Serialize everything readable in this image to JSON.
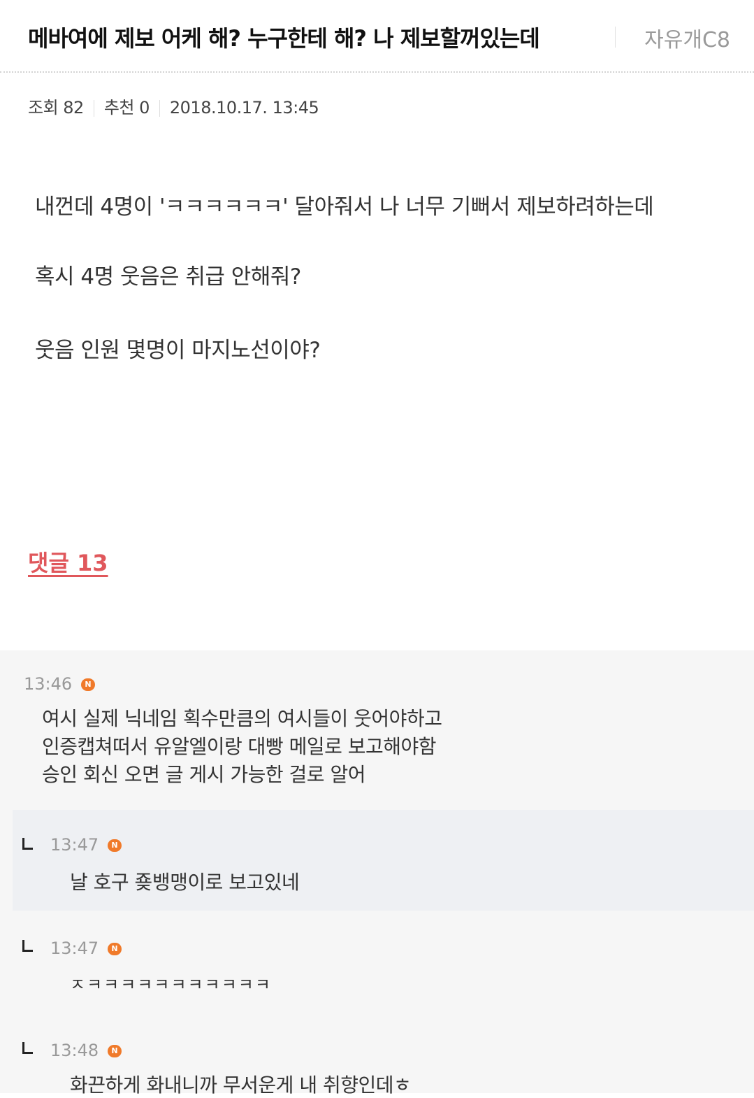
{
  "post": {
    "title": "메바여에 제보 어케 해? 누구한테 해? 나 제보할꺼있는데",
    "board": "자유개C8",
    "views": "조회 82",
    "recommend": "추천 0",
    "date": "2018.10.17. 13:45",
    "body": [
      "내껀데 4명이 'ㅋㅋㅋㅋㅋㅋ' 달아줘서 나 너무 기뻐서 제보하려하는데",
      "혹시 4명 웃음은 취급 안해줘?",
      "웃음 인원 몇명이 마지노선이야?"
    ]
  },
  "comments_link": "댓글 13",
  "comments": [
    {
      "time": "13:46",
      "badge": "N",
      "lines": [
        "여시 실제 닉네임 획수만큼의 여시들이 웃어야하고",
        "인증캡쳐떠서 유알엘이랑 대빵 메일로 보고해야함",
        "승인 회신 오면 글 게시 가능한 걸로 알어"
      ]
    },
    {
      "time": "13:47",
      "badge": "N",
      "text": "날 호구 죶뱅맹이로 보고있네",
      "reply": true
    },
    {
      "time": "13:47",
      "badge": "N",
      "text": "ㅈㅋㅋㅋㅋㅋㅋㅋㅋㅋㅋㅋ",
      "reply": true
    },
    {
      "time": "13:48",
      "badge": "N",
      "text": "화끈하게 화내니까 무서운게 내 취향인데ㅎ",
      "reply": true
    }
  ]
}
